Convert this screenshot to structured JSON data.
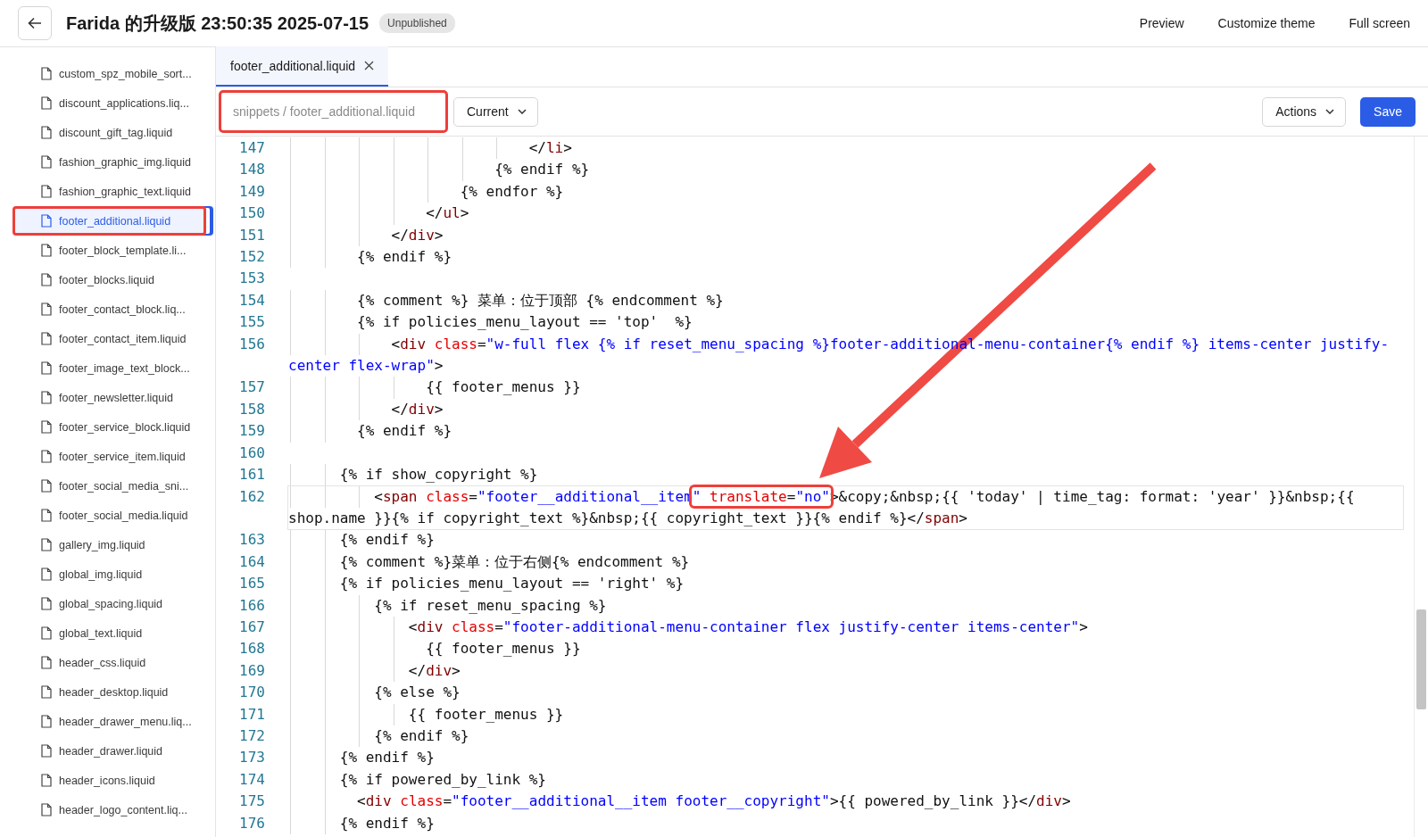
{
  "header": {
    "title": "Farida 的升级版 23:50:35 2025-07-15",
    "status_badge": "Unpublished",
    "links": [
      "Preview",
      "Customize theme",
      "Full screen"
    ]
  },
  "sidebar": {
    "files": [
      {
        "name": "custom_spz_mobile_sort...",
        "selected": false,
        "annotated": false
      },
      {
        "name": "discount_applications.liq...",
        "selected": false,
        "annotated": false
      },
      {
        "name": "discount_gift_tag.liquid",
        "selected": false,
        "annotated": false
      },
      {
        "name": "fashion_graphic_img.liquid",
        "selected": false,
        "annotated": false
      },
      {
        "name": "fashion_graphic_text.liquid",
        "selected": false,
        "annotated": false
      },
      {
        "name": "footer_additional.liquid",
        "selected": true,
        "annotated": true
      },
      {
        "name": "footer_block_template.li...",
        "selected": false,
        "annotated": false
      },
      {
        "name": "footer_blocks.liquid",
        "selected": false,
        "annotated": false
      },
      {
        "name": "footer_contact_block.liq...",
        "selected": false,
        "annotated": false
      },
      {
        "name": "footer_contact_item.liquid",
        "selected": false,
        "annotated": false
      },
      {
        "name": "footer_image_text_block...",
        "selected": false,
        "annotated": false
      },
      {
        "name": "footer_newsletter.liquid",
        "selected": false,
        "annotated": false
      },
      {
        "name": "footer_service_block.liquid",
        "selected": false,
        "annotated": false
      },
      {
        "name": "footer_service_item.liquid",
        "selected": false,
        "annotated": false
      },
      {
        "name": "footer_social_media_sni...",
        "selected": false,
        "annotated": false
      },
      {
        "name": "footer_social_media.liquid",
        "selected": false,
        "annotated": false
      },
      {
        "name": "gallery_img.liquid",
        "selected": false,
        "annotated": false
      },
      {
        "name": "global_img.liquid",
        "selected": false,
        "annotated": false
      },
      {
        "name": "global_spacing.liquid",
        "selected": false,
        "annotated": false
      },
      {
        "name": "global_text.liquid",
        "selected": false,
        "annotated": false
      },
      {
        "name": "header_css.liquid",
        "selected": false,
        "annotated": false
      },
      {
        "name": "header_desktop.liquid",
        "selected": false,
        "annotated": false
      },
      {
        "name": "header_drawer_menu.liq...",
        "selected": false,
        "annotated": false
      },
      {
        "name": "header_drawer.liquid",
        "selected": false,
        "annotated": false
      },
      {
        "name": "header_icons.liquid",
        "selected": false,
        "annotated": false
      },
      {
        "name": "header_logo_content.liq...",
        "selected": false,
        "annotated": false
      }
    ]
  },
  "editor": {
    "tabs": [
      {
        "label": "footer_additional.liquid",
        "selected": true
      }
    ],
    "path": {
      "value": "snippets / footer_additional.liquid",
      "annotated": true
    },
    "version_select": "Current",
    "actions_menu": "Actions",
    "save_button": "Save",
    "lines": [
      {
        "number": "147",
        "current": false,
        "tokens": [
          {
            "kind": "plain",
            "text": "                            </"
          },
          {
            "kind": "tag",
            "text": "li"
          },
          {
            "kind": "plain",
            "text": ">"
          }
        ]
      },
      {
        "number": "148",
        "current": false,
        "tokens": [
          {
            "kind": "plain",
            "text": "                        {% endif %}"
          }
        ]
      },
      {
        "number": "149",
        "current": false,
        "tokens": [
          {
            "kind": "plain",
            "text": "                    {% endfor %}"
          }
        ]
      },
      {
        "number": "150",
        "current": false,
        "tokens": [
          {
            "kind": "plain",
            "text": "                </"
          },
          {
            "kind": "tag",
            "text": "ul"
          },
          {
            "kind": "plain",
            "text": ">"
          }
        ]
      },
      {
        "number": "151",
        "current": false,
        "tokens": [
          {
            "kind": "plain",
            "text": "            </"
          },
          {
            "kind": "tag",
            "text": "div"
          },
          {
            "kind": "plain",
            "text": ">"
          }
        ]
      },
      {
        "number": "152",
        "current": false,
        "tokens": [
          {
            "kind": "plain",
            "text": "        {% endif %}"
          }
        ]
      },
      {
        "number": "153"
      },
      {
        "number": "154",
        "current": false,
        "tokens": [
          {
            "kind": "plain",
            "text": "        {% comment %} 菜单：位于顶部 {% endcomment %}"
          }
        ]
      },
      {
        "number": "155",
        "current": false,
        "tokens": [
          {
            "kind": "plain",
            "text": "        {% if policies_menu_layout == 'top'  %}"
          }
        ]
      },
      {
        "number": "156",
        "current": false,
        "tokens": [
          {
            "kind": "plain",
            "text": "            <"
          },
          {
            "kind": "tag",
            "text": "div"
          },
          {
            "kind": "attr",
            "text": " class"
          },
          {
            "kind": "plain",
            "text": "="
          },
          {
            "kind": "string",
            "text": "\"w-full flex {% if reset_menu_spacing %}footer-additional-menu-container{% endif %} items-center justify-center flex-wrap\""
          },
          {
            "kind": "plain",
            "text": ">"
          }
        ]
      },
      {
        "number": "157",
        "current": false,
        "tokens": [
          {
            "kind": "plain",
            "text": "                {{ footer_menus }}"
          }
        ]
      },
      {
        "number": "158",
        "current": false,
        "tokens": [
          {
            "kind": "plain",
            "text": "            </"
          },
          {
            "kind": "tag",
            "text": "div"
          },
          {
            "kind": "plain",
            "text": ">"
          }
        ]
      },
      {
        "number": "159",
        "current": false,
        "tokens": [
          {
            "kind": "plain",
            "text": "        {% endif %}"
          }
        ]
      },
      {
        "number": "160"
      },
      {
        "number": "161",
        "current": false,
        "tokens": [
          {
            "kind": "plain",
            "text": "      {% if show_copyright %}"
          }
        ]
      },
      {
        "number": "162",
        "current": true,
        "tokens": [
          {
            "kind": "plain",
            "text": "          <"
          },
          {
            "kind": "tag",
            "text": "span"
          },
          {
            "kind": "attr",
            "text": " class"
          },
          {
            "kind": "plain",
            "text": "="
          },
          {
            "kind": "string",
            "text": "\"footer__additional__item"
          },
          {
            "kind": "mark",
            "tokens": [
              {
                "kind": "string",
                "text": "\""
              },
              {
                "kind": "attr",
                "text": " translate"
              },
              {
                "kind": "plain",
                "text": "="
              },
              {
                "kind": "string",
                "text": "\"no\""
              }
            ]
          },
          {
            "kind": "plain",
            "text": ">&copy;&nbsp;{{ 'today' | time_tag: format: 'year' }}&nbsp;{{ shop.name }}{% if copyright_text %}&nbsp;{{ copyright_text }}{% endif %}</"
          },
          {
            "kind": "tag",
            "text": "span"
          },
          {
            "kind": "plain",
            "text": ">"
          }
        ]
      },
      {
        "number": "163",
        "current": false,
        "tokens": [
          {
            "kind": "plain",
            "text": "      {% endif %}"
          }
        ]
      },
      {
        "number": "164",
        "current": false,
        "tokens": [
          {
            "kind": "plain",
            "text": "      {% comment %}菜单：位于右侧{% endcomment %}"
          }
        ]
      },
      {
        "number": "165",
        "current": false,
        "tokens": [
          {
            "kind": "plain",
            "text": "      {% if policies_menu_layout == 'right' %}"
          }
        ]
      },
      {
        "number": "166",
        "current": false,
        "tokens": [
          {
            "kind": "plain",
            "text": "          {% if reset_menu_spacing %}"
          }
        ]
      },
      {
        "number": "167",
        "current": false,
        "tokens": [
          {
            "kind": "plain",
            "text": "              <"
          },
          {
            "kind": "tag",
            "text": "div"
          },
          {
            "kind": "attr",
            "text": " class"
          },
          {
            "kind": "plain",
            "text": "="
          },
          {
            "kind": "string",
            "text": "\"footer-additional-menu-container flex justify-center items-center\""
          },
          {
            "kind": "plain",
            "text": ">"
          }
        ]
      },
      {
        "number": "168",
        "current": false,
        "tokens": [
          {
            "kind": "plain",
            "text": "                {{ footer_menus }}"
          }
        ]
      },
      {
        "number": "169",
        "current": false,
        "tokens": [
          {
            "kind": "plain",
            "text": "              </"
          },
          {
            "kind": "tag",
            "text": "div"
          },
          {
            "kind": "plain",
            "text": ">"
          }
        ]
      },
      {
        "number": "170",
        "current": false,
        "tokens": [
          {
            "kind": "plain",
            "text": "          {% else %}"
          }
        ]
      },
      {
        "number": "171",
        "current": false,
        "tokens": [
          {
            "kind": "plain",
            "text": "              {{ footer_menus }}"
          }
        ]
      },
      {
        "number": "172",
        "current": false,
        "tokens": [
          {
            "kind": "plain",
            "text": "          {% endif %}"
          }
        ]
      },
      {
        "number": "173",
        "current": false,
        "tokens": [
          {
            "kind": "plain",
            "text": "      {% endif %}"
          }
        ]
      },
      {
        "number": "174",
        "current": false,
        "tokens": [
          {
            "kind": "plain",
            "text": "      {% if powered_by_link %}"
          }
        ]
      },
      {
        "number": "175",
        "current": false,
        "tokens": [
          {
            "kind": "plain",
            "text": "        <"
          },
          {
            "kind": "tag",
            "text": "div"
          },
          {
            "kind": "attr",
            "text": " class"
          },
          {
            "kind": "plain",
            "text": "="
          },
          {
            "kind": "string",
            "text": "\"footer__additional__item footer__copyright\""
          },
          {
            "kind": "plain",
            "text": ">{{ powered_by_link }}</"
          },
          {
            "kind": "tag",
            "text": "div"
          },
          {
            "kind": "plain",
            "text": ">"
          }
        ]
      },
      {
        "number": "176",
        "current": false,
        "tokens": [
          {
            "kind": "plain",
            "text": "      {% endif %}"
          }
        ]
      }
    ]
  }
}
